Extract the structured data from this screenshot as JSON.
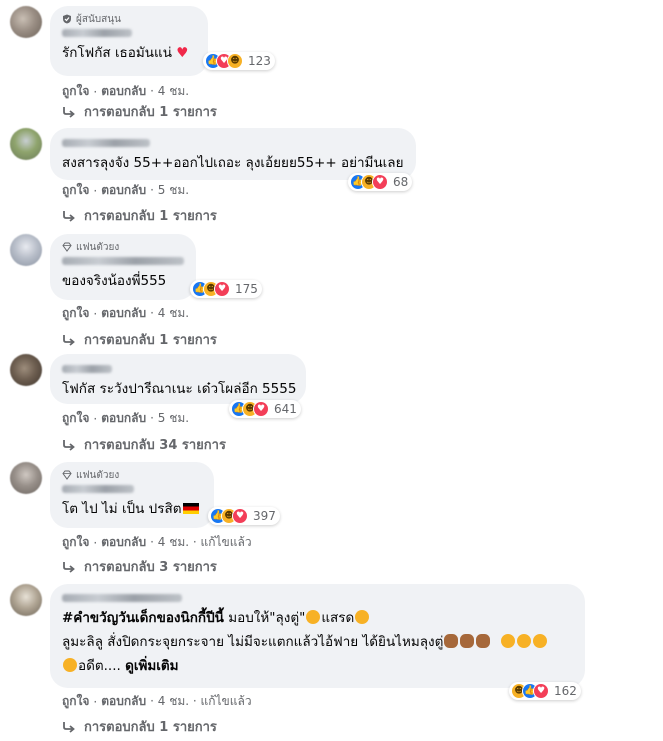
{
  "comments": [
    {
      "badge": "ผู้สนับสนุน",
      "text": "รักโฟกัส เธอมันแน่",
      "reaction_count": "123",
      "like": "ถูกใจ",
      "reply": "ตอบกลับ",
      "time": "· 4 ชม.",
      "replies": "การตอบกลับ 1 รายการ"
    },
    {
      "text": "สงสารลุงจัง 55++ออกไปเถอะ ลุงเอ้ยยย55++ อย่ามีนเลย",
      "reaction_count": "68",
      "like": "ถูกใจ",
      "reply": "ตอบกลับ",
      "time": "· 5 ชม.",
      "replies": "การตอบกลับ 1 รายการ"
    },
    {
      "badge": "แฟนตัวยง",
      "text": "ของจริงน้องพี่555",
      "reaction_count": "175",
      "like": "ถูกใจ",
      "reply": "ตอบกลับ",
      "time": "· 4 ชม.",
      "replies": "การตอบกลับ 1 รายการ"
    },
    {
      "text": "โฟกัส ระวังปารีณาเนะ เด๋วโผล่อีก 5555",
      "reaction_count": "641",
      "like": "ถูกใจ",
      "reply": "ตอบกลับ",
      "time": "· 5 ชม.",
      "replies": "การตอบกลับ 34 รายการ"
    },
    {
      "badge": "แฟนตัวยง",
      "text": "โต ไป ไม่ เป็น ปรสิต",
      "reaction_count": "397",
      "like": "ถูกใจ",
      "reply": "ตอบกลับ",
      "time": "· 4 ชม. · แก้ไขแล้ว",
      "replies": "การตอบกลับ 3 รายการ"
    },
    {
      "line1_hashtag": "#คำขวัญวันเด็กของนิกกี้ปีนี้",
      "line1_rest": " มอบให้\"ลุงตู่\"",
      "line1_end": "แสรด",
      "line2": "ลูมะลิลู สั่งปิดกระจุยกระจาย ไม่มีจะแตกแล้วไอ้ฟาย ได้ยินไหมลุงตู่",
      "line3": "อดีต.... ",
      "see_more": "ดูเพิ่มเติม",
      "reaction_count": "162",
      "like": "ถูกใจ",
      "reply": "ตอบกลับ",
      "time": "· 4 ชม. · แก้ไขแล้ว",
      "replies": "การตอบกลับ 1 รายการ"
    }
  ]
}
